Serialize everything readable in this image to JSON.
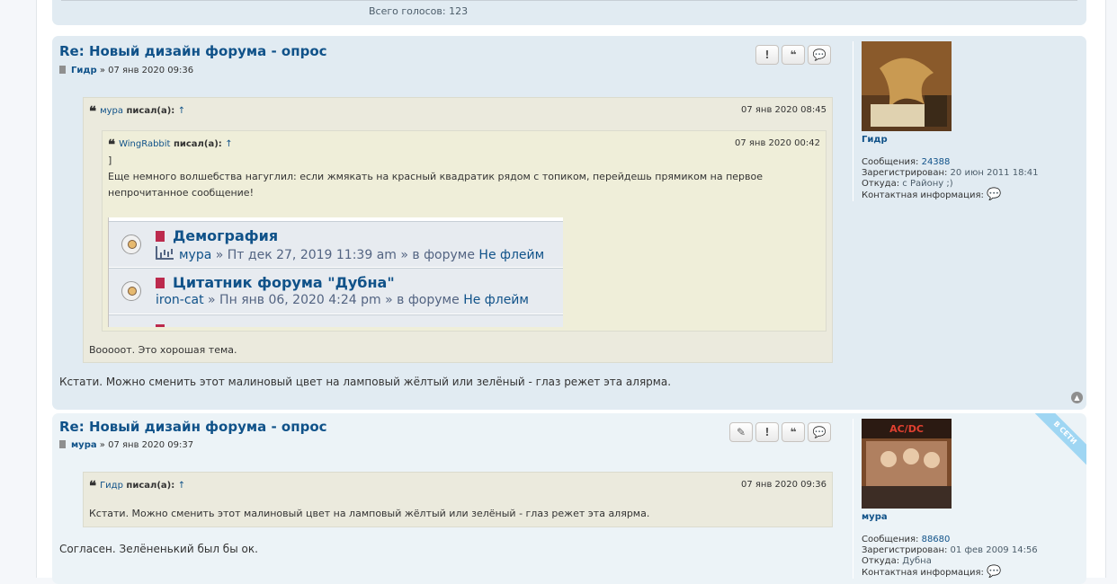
{
  "prev": {
    "total_votes": "Всего голосов: 123"
  },
  "posts": [
    {
      "title": "Re: Новый дизайн форума - опрос",
      "author": "Гидр",
      "sep": "»",
      "date": "07 янв 2020 09:36",
      "buttons": [
        "!",
        "❝",
        "💬"
      ],
      "quote": {
        "author": "мура",
        "wrote": "писал(а):",
        "arrow": "↑",
        "date": "07 янв 2020 08:45",
        "nested": {
          "author": "WingRabbit",
          "wrote": "писал(а):",
          "arrow": "↑",
          "date": "07 янв 2020 00:42",
          "bracket": "]",
          "text": "Еще немного волшебства нагуглил: если жмякать на красный квадратик рядом с топиком, перейдешь прямиком на первое непрочитанное сообщение!",
          "topics": [
            {
              "title": "Демография",
              "author": "мура",
              "meta": " » Пт дек 27, 2019 11:39 am » в форуме ",
              "forum": "Не флейм"
            },
            {
              "title": "Цитатник форума \"Дубна\"",
              "author": "iron-cat",
              "meta": " » Пн янв 06, 2020 4:24 pm » в форуме ",
              "forum": "Не флейм"
            }
          ]
        },
        "text": "Вооооот. Это хорошая тема."
      },
      "text": "Кстати. Можно сменить этот малиновый цвет на ламповый жёлтый или зелёный - глаз режет эта алярма.",
      "profile": {
        "name": "Гидр",
        "messages_label": "Сообщения:",
        "messages": "24388",
        "registered_label": "Зарегистрирован:",
        "registered": "20 июн 2011 18:41",
        "from_label": "Откуда:",
        "from": "с Району ;)",
        "contact_label": "Контактная информация:"
      }
    },
    {
      "title": "Re: Новый дизайн форума - опрос",
      "author": "мура",
      "sep": "»",
      "date": "07 янв 2020 09:37",
      "buttons": [
        "✎",
        "!",
        "❝",
        "💬"
      ],
      "quote": {
        "author": "Гидр",
        "wrote": "писал(а):",
        "arrow": "↑",
        "date": "07 янв 2020 09:36",
        "text": "Кстати. Можно сменить этот малиновый цвет на ламповый жёлтый или зелёный - глаз режет эта алярма."
      },
      "text": "Согласен. Зелёненький был бы ок.",
      "online": "В СЕТИ",
      "profile": {
        "name": "мура",
        "avatar_text": "AC/DC",
        "messages_label": "Сообщения:",
        "messages": "88680",
        "registered_label": "Зарегистрирован:",
        "registered": "01 фев 2009 14:56",
        "from_label": "Откуда:",
        "from": "Дубна",
        "contact_label": "Контактная информация:"
      }
    }
  ]
}
